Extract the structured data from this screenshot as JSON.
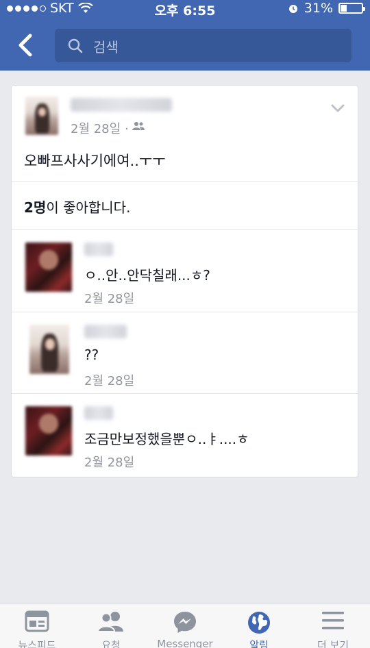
{
  "status_bar": {
    "carrier": "SKT",
    "time": "오후 6:55",
    "battery_percent_text": "31%",
    "battery_level": 0.31
  },
  "nav": {
    "back_icon": "chevron-left-icon",
    "search_placeholder": "검색"
  },
  "post": {
    "author_blurred": true,
    "date": "2월 28일",
    "dot": "·",
    "privacy_icon": "friends-icon",
    "text": "오빠프사사기에여..ㅜㅜ",
    "likes_count": "2명",
    "likes_suffix": "이 좋아합니다."
  },
  "comments": [
    {
      "text": "ㅇ..안..안닥칠래...ㅎ?",
      "date": "2월 28일"
    },
    {
      "text": "??",
      "date": "2월 28일"
    },
    {
      "text": "조금만보정했을뿐ㅇ..ㅑ....ㅎ",
      "date": "2월 28일"
    }
  ],
  "tabbar": {
    "items": [
      {
        "label": "뉴스피드",
        "icon": "newsfeed-icon"
      },
      {
        "label": "요청",
        "icon": "friend-requests-icon"
      },
      {
        "label": "Messenger",
        "icon": "messenger-icon"
      },
      {
        "label": "알림",
        "icon": "globe-icon",
        "active": true
      },
      {
        "label": "더 보기",
        "icon": "menu-icon"
      }
    ]
  },
  "colors": {
    "header_blue": "#4267b2",
    "search_bg": "#365899",
    "background": "#e9eaed",
    "meta_gray": "#90949c"
  }
}
